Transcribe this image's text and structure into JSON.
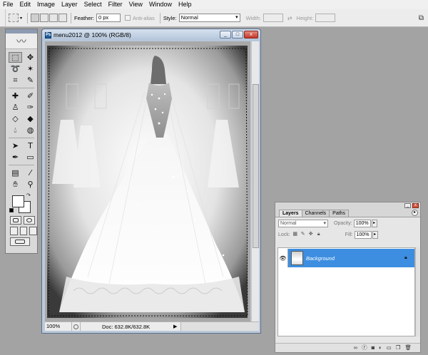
{
  "menubar": {
    "items": [
      "File",
      "Edit",
      "Image",
      "Layer",
      "Select",
      "Filter",
      "View",
      "Window",
      "Help"
    ]
  },
  "options": {
    "feather_label": "Feather:",
    "feather_value": "0 px",
    "antialias_label": "Anti-alias",
    "style_label": "Style:",
    "style_value": "Normal",
    "width_label": "Width:",
    "height_label": "Height:"
  },
  "document": {
    "title": "menu2012 @ 100% (RGB/8)",
    "zoom": "100%",
    "doc_size": "Doc: 632.8K/632.8K",
    "window_buttons": {
      "minimize": "_",
      "maximize": "□",
      "close": "x"
    }
  },
  "layers": {
    "tabs": [
      "Layers",
      "Channels",
      "Paths"
    ],
    "blend_mode": "Normal",
    "opacity_label": "Opacity:",
    "opacity_value": "100%",
    "lock_label": "Lock:",
    "fill_label": "Fill:",
    "fill_value": "100%",
    "items": [
      {
        "name": "Background",
        "visible": true,
        "locked": true
      }
    ],
    "footer_icons": [
      "link-icon",
      "fx-icon",
      "mask-icon",
      "adjustment-icon",
      "group-icon",
      "new-layer-icon",
      "delete-icon"
    ]
  },
  "colors": {
    "accent": "#3d8ee0",
    "app_background": "#a3a3a3",
    "title_bar": "#c5d3e4"
  }
}
